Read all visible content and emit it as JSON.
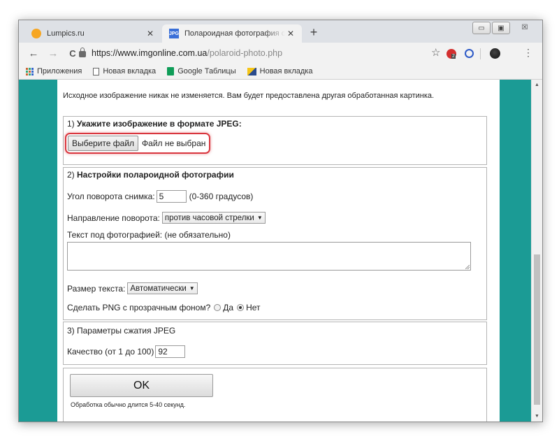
{
  "browser": {
    "tabs": [
      {
        "title": "Lumpics.ru",
        "active": false,
        "favicon": "lumpics-favicon"
      },
      {
        "title": "Полароидная фотография онлайн",
        "active": true,
        "favicon": "imgonline-jpg-favicon",
        "favicon_text": "JPG"
      }
    ],
    "tab_close_glyph": "✕",
    "new_tab_glyph": "+",
    "window_controls": {
      "minimize": "▭",
      "maximize": "▣",
      "close": "☒"
    },
    "nav": {
      "back": "←",
      "forward": "→",
      "reload": "C"
    },
    "url_host": "https://www.imgonline.com.ua",
    "url_path": "/polaroid-photo.php",
    "star": "☆",
    "extension_badge": "2",
    "menu_glyph": "⋮",
    "bookmarks": [
      {
        "label": "Приложения",
        "icon": "apps-grid-icon"
      },
      {
        "label": "Новая вкладка",
        "icon": "page-icon"
      },
      {
        "label": "Google Таблицы",
        "icon": "google-sheets-icon"
      },
      {
        "label": "Новая вкладка",
        "icon": "image-icon"
      }
    ]
  },
  "page": {
    "intro": "Исходное изображение никак не изменяется. Вам будет предоставлена другая обработанная картинка.",
    "section1": {
      "number": "1) ",
      "title": "Укажите изображение в формате JPEG:",
      "button_label": "Выберите файл",
      "file_status": "Файл не выбран"
    },
    "section2": {
      "number": "2) ",
      "title": "Настройки полароидной фотографии",
      "angle_label": "Угол поворота снимка:",
      "angle_value": "5",
      "angle_hint": "(0-360 градусов)",
      "direction_label": "Направление поворота:",
      "direction_value": "против часовой стрелки",
      "caption_label": "Текст под фотографией: (не обязательно)",
      "caption_value": "",
      "text_size_label": "Размер текста:",
      "text_size_value": "Автоматически",
      "png_label": "Сделать PNG с прозрачным фоном?",
      "png_yes": "Да",
      "png_no": "Нет",
      "png_selected": "Нет"
    },
    "section3": {
      "title": "3) Параметры сжатия JPEG",
      "quality_label": "Качество (от 1 до 100)",
      "quality_value": "92"
    },
    "section4": {
      "ok_label": "OK",
      "note": "Обработка обычно длится 5-40 секунд."
    },
    "select_arrow": "▼"
  },
  "colors": {
    "page_background": "#1b9b95",
    "highlight_border": "#d9363e"
  }
}
